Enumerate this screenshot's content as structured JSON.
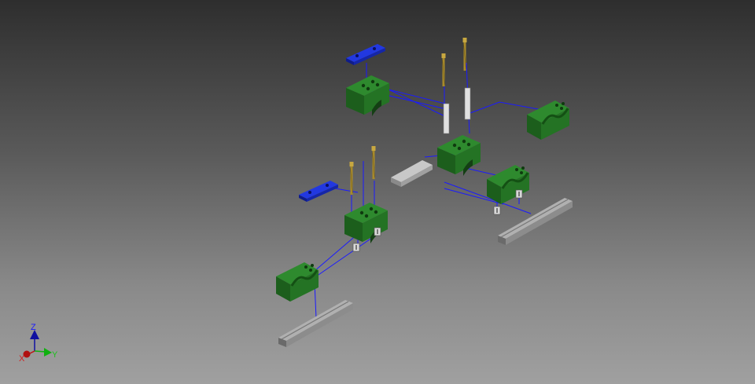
{
  "viewport": {
    "axis_triad": {
      "x_label": "X",
      "y_label": "Y",
      "z_label": "Z"
    }
  },
  "colors": {
    "clamp": "#1f6b1f",
    "plate": "#1a2fc4",
    "screw": "#a88a2a",
    "rail": "#8c8c8c",
    "trail": "#1a1aff",
    "axis_x": "#c01010",
    "axis_y": "#10b010",
    "axis_z": "#1010a0"
  }
}
